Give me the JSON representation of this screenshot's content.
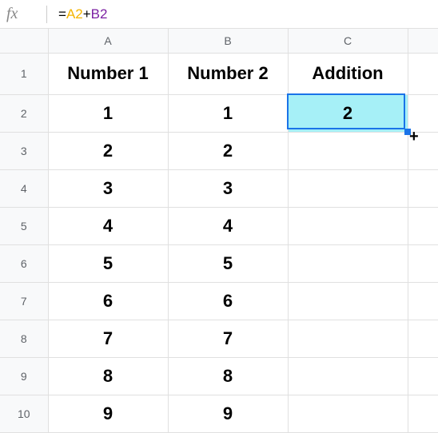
{
  "formula_bar": {
    "fx_label": "fx",
    "equals": "=",
    "ref_a": "A2",
    "plus": "+",
    "ref_b": "B2"
  },
  "columns": {
    "a": "A",
    "b": "B",
    "c": "C"
  },
  "row_numbers": {
    "r1": "1",
    "r2": "2",
    "r3": "3",
    "r4": "4",
    "r5": "5",
    "r6": "6",
    "r7": "7",
    "r8": "8",
    "r9": "9",
    "r10": "10"
  },
  "headers": {
    "a": "Number 1",
    "b": "Number 2",
    "c": "Addition"
  },
  "rows": {
    "r2": {
      "a": "1",
      "b": "1",
      "c": "2"
    },
    "r3": {
      "a": "2",
      "b": "2",
      "c": ""
    },
    "r4": {
      "a": "3",
      "b": "3",
      "c": ""
    },
    "r5": {
      "a": "4",
      "b": "4",
      "c": ""
    },
    "r6": {
      "a": "5",
      "b": "5",
      "c": ""
    },
    "r7": {
      "a": "6",
      "b": "6",
      "c": ""
    },
    "r8": {
      "a": "7",
      "b": "7",
      "c": ""
    },
    "r9": {
      "a": "8",
      "b": "8",
      "c": ""
    },
    "r10": {
      "a": "9",
      "b": "9",
      "c": ""
    }
  },
  "chart_data": {
    "type": "table",
    "columns": [
      "Number 1",
      "Number 2",
      "Addition"
    ],
    "data": [
      [
        1,
        1,
        2
      ],
      [
        2,
        2,
        null
      ],
      [
        3,
        3,
        null
      ],
      [
        4,
        4,
        null
      ],
      [
        5,
        5,
        null
      ],
      [
        6,
        6,
        null
      ],
      [
        7,
        7,
        null
      ],
      [
        8,
        8,
        null
      ],
      [
        9,
        9,
        null
      ]
    ],
    "selected_cell": "C2",
    "formula": "=A2+B2"
  }
}
